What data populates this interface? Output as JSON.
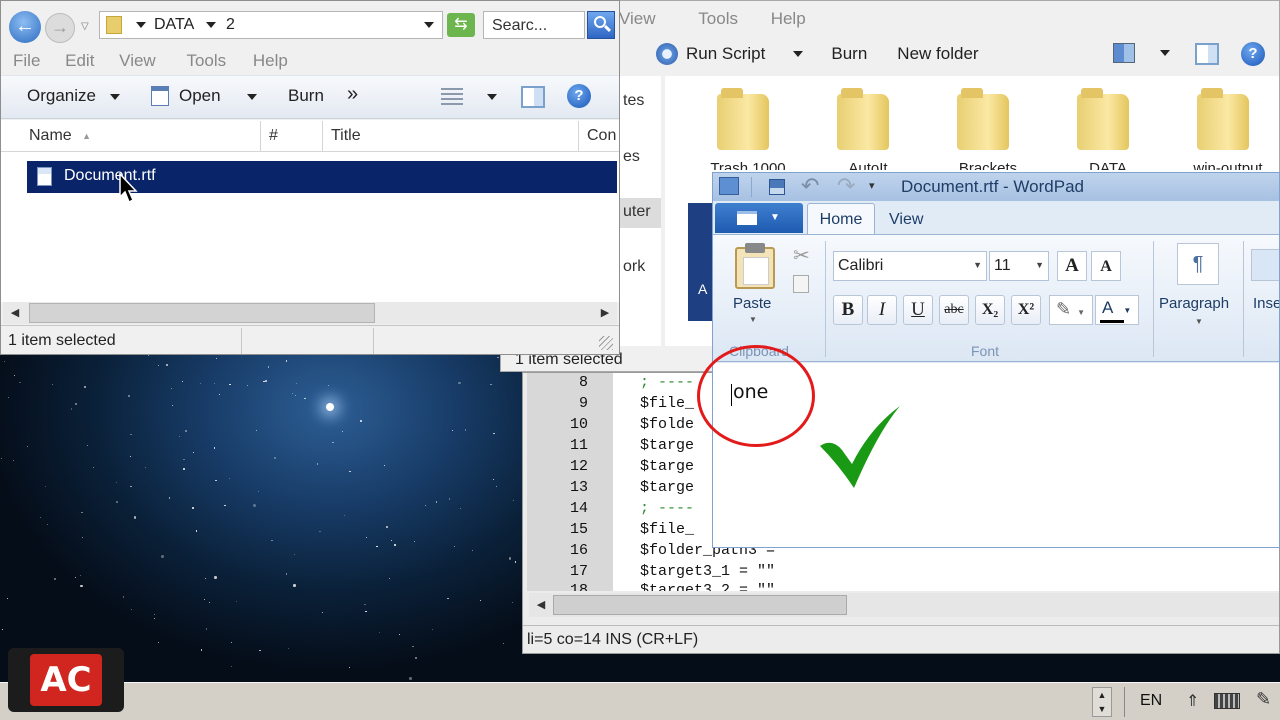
{
  "explorer_front": {
    "path": [
      "DATA",
      "2"
    ],
    "search_placeholder": "Searc...",
    "menu": [
      "File",
      "Edit",
      "View",
      "Tools",
      "Help"
    ],
    "toolbar": {
      "organize": "Organize",
      "open": "Open",
      "burn": "Burn",
      "more": "»"
    },
    "columns": [
      "Name",
      "#",
      "Title",
      "Con"
    ],
    "files": [
      {
        "name": "Document.rtf"
      }
    ],
    "status": "1 item selected"
  },
  "explorer_back": {
    "menu": [
      "View",
      "Tools",
      "Help"
    ],
    "toolbar": {
      "run_script": "Run Script",
      "burn": "Burn",
      "new_folder": "New folder"
    },
    "side_items": [
      "tes",
      "es",
      "uter",
      "ork"
    ],
    "folders": [
      "Trash 1000",
      "AutoIt",
      "Brackets",
      "DATA",
      "win-output"
    ],
    "status": "1 item selected"
  },
  "editor": {
    "line_numbers": [
      "8",
      "9",
      "10",
      "11",
      "12",
      "13",
      "14",
      "15",
      "16",
      "17",
      "18"
    ],
    "lines": [
      "; ----",
      "$file_",
      "$folde",
      "$targe",
      "$targe",
      "$targe",
      "; ----",
      "$file_",
      "$folder_path3 =",
      "$target3_1 = \"\"",
      "$target3_2 = \"\""
    ],
    "status": "li=5 co=14 INS (CR+LF)"
  },
  "wordpad": {
    "title": "Document.rtf - WordPad",
    "tabs": {
      "home": "Home",
      "view": "View"
    },
    "clipboard": {
      "paste": "Paste",
      "group": "Clipboard"
    },
    "font": {
      "family": "Calibri",
      "size": "11",
      "group": "Font",
      "buttons": [
        "B",
        "I",
        "U",
        "abc",
        "X₂",
        "X²"
      ]
    },
    "paragraph": "Paragraph",
    "insert": "Inse",
    "content": "one"
  },
  "taskbar": {
    "language": "EN"
  },
  "logo": "AC",
  "colors": {
    "selection": "#0a246a",
    "annotation": "#e31a1a",
    "check": "#1a9a14",
    "logo_bg": "#d0261f"
  }
}
